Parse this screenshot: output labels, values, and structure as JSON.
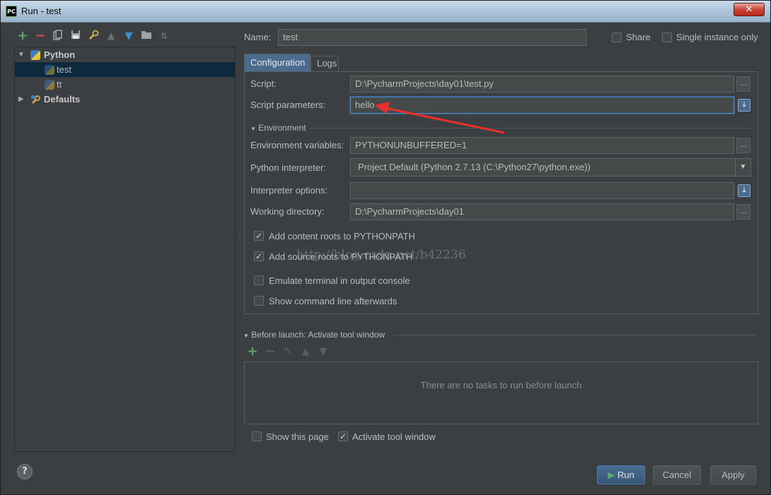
{
  "window": {
    "title": "Run - test",
    "app_badge": "PC",
    "close_glyph": "✕"
  },
  "toolbar": {
    "icons": [
      "add-icon",
      "remove-icon",
      "copy-icon",
      "save-icon",
      "wrench-icon",
      "move-up-icon",
      "move-down-icon",
      "folder-icon",
      "sort-icon"
    ],
    "add_glyph": "+",
    "remove_glyph": "−",
    "up_glyph": "🡑",
    "down_glyph": "🡓"
  },
  "tree": {
    "python_label": "Python",
    "items": [
      {
        "label": "test",
        "selected": true
      },
      {
        "label": "tt",
        "selected": false
      }
    ],
    "defaults_label": "Defaults"
  },
  "header": {
    "name_label": "Name:",
    "name_value": "test",
    "share_label": "Share",
    "single_instance_label": "Single instance only",
    "share_checked": false,
    "single_instance_checked": false
  },
  "tabs": {
    "configuration": "Configuration",
    "logs": "Logs"
  },
  "config": {
    "script_label": "Script:",
    "script_value": "D:\\PycharmProjects\\day01\\test.py",
    "params_label": "Script parameters:",
    "params_value": "hello",
    "environment_header": "Environment",
    "env_vars_label": "Environment variables:",
    "env_vars_value": "PYTHONUNBUFFERED=1",
    "interpreter_label": "Python interpreter:",
    "interpreter_value": "Project Default (Python 2.7.13 (C:\\Python27\\python.exe))",
    "interp_opts_label": "Interpreter options:",
    "interp_opts_value": "",
    "workdir_label": "Working directory:",
    "workdir_value": "D:\\PycharmProjects\\day01",
    "dots": "...",
    "checkboxes": [
      {
        "label": "Add content roots to PYTHONPATH",
        "checked": true
      },
      {
        "label": "Add source roots to PYTHONPATH",
        "checked": true
      },
      {
        "label": "Emulate terminal in output console",
        "checked": false
      },
      {
        "label": "Show command line afterwards",
        "checked": false
      }
    ]
  },
  "before_launch": {
    "header": "Before launch: Activate tool window",
    "empty_message": "There are no tasks to run before launch"
  },
  "footer": {
    "show_page_label": "Show this page",
    "show_page_checked": false,
    "activate_label": "Activate tool window",
    "activate_checked": true,
    "run_label": "Run",
    "cancel_label": "Cancel",
    "apply_label": "Apply",
    "help_glyph": "?"
  },
  "watermark": "http://blog.csdn.net/b42236",
  "colors": {
    "accent": "#4a88c7",
    "annotation_arrow": "#e8302a",
    "add_green": "#59a869",
    "remove_red": "#c75450"
  }
}
